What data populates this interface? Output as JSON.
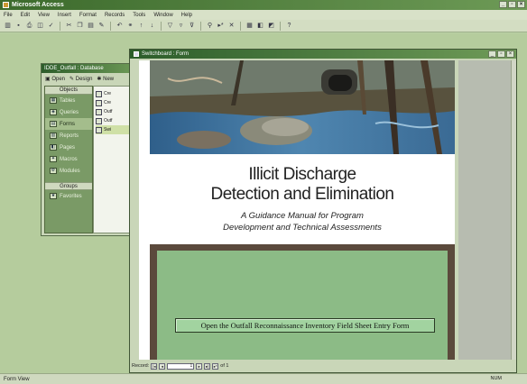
{
  "app": {
    "title": "Microsoft Access"
  },
  "menubar": [
    "File",
    "Edit",
    "View",
    "Insert",
    "Format",
    "Records",
    "Tools",
    "Window",
    "Help"
  ],
  "database_window": {
    "title": "IDDE_Outfall : Database",
    "toolbar": {
      "open": "Open",
      "design": "Design",
      "new": "New"
    },
    "objects_header": "Objects",
    "objects": [
      "Tables",
      "Queries",
      "Forms",
      "Reports",
      "Pages",
      "Macros",
      "Modules"
    ],
    "selected_object": "Forms",
    "groups_header": "Groups",
    "groups": [
      "Favorites"
    ],
    "list_items": [
      "Cre",
      "Cre",
      "Outf",
      "Outf",
      "Swi"
    ]
  },
  "form_window": {
    "title": "Switchboard : Form",
    "headline_line1": "Illicit Discharge",
    "headline_line2": "Detection and Elimination",
    "subtitle_line1": "A Guidance Manual for Program",
    "subtitle_line2": "Development and Technical Assessments",
    "open_button": "Open the Outfall Reconnaissance Inventory Field Sheet Entry Form",
    "nav": {
      "label": "Record:",
      "current": "1",
      "total": "of 1"
    }
  },
  "statusbar": {
    "mode": "Form View",
    "num": "NUM"
  }
}
